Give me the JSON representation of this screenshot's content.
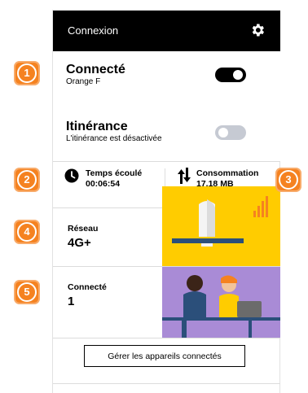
{
  "header": {
    "title": "Connexion",
    "settings_icon": "gear-icon"
  },
  "connection": {
    "status_label": "Connecté",
    "operator": "Orange F",
    "data_toggle_on": true,
    "roaming_label": "Itinérance",
    "roaming_status": "L'itinérance est désactivée",
    "roaming_toggle_on": false
  },
  "stats": {
    "elapsed_label": "Temps écoulé",
    "elapsed_value": "00:06:54",
    "consumption_label": "Consommation",
    "consumption_value": "17.18 MB"
  },
  "network": {
    "label": "Réseau",
    "value": "4G+"
  },
  "devices": {
    "label": "Connecté",
    "value": "1"
  },
  "actions": {
    "manage_devices": "Gérer les appareils connectés"
  },
  "callouts": [
    "1",
    "2",
    "3",
    "4",
    "5"
  ],
  "colors": {
    "accent": "#f58220",
    "header_bg": "#000000",
    "network_tile": "#ffcc00",
    "devices_tile": "#a98bd6"
  }
}
